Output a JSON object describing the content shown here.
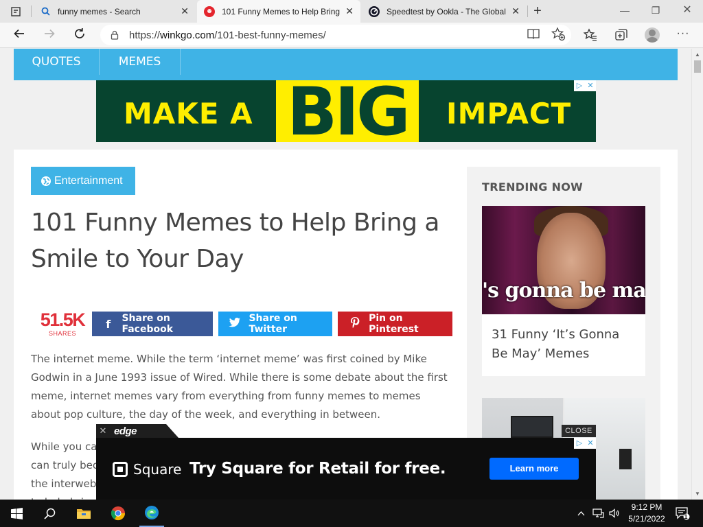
{
  "browser": {
    "tabs": [
      {
        "title": "funny memes - Search",
        "icon": "search-icon"
      },
      {
        "title": "101 Funny Memes to Help Bring",
        "icon": "winkgo-icon"
      },
      {
        "title": "Speedtest by Ookla - The Global",
        "icon": "speedtest-icon"
      }
    ],
    "tab_close": "✕",
    "new_tab": "+",
    "window": {
      "minimize": "—",
      "restore": "❐",
      "close": "✕"
    },
    "address": {
      "prefix": "https://",
      "domain": "winkgo.com",
      "path": "/101-best-funny-memes/"
    },
    "more": "···"
  },
  "site": {
    "nav": [
      "QUOTES",
      "MEMES"
    ],
    "ad_top": {
      "left": "MAKE A",
      "big": "BIG",
      "right": "IMPACT",
      "choices": [
        "▷",
        "✕"
      ]
    },
    "category": "Entertainment",
    "headline": "101 Funny Memes to Help Bring a Smile to Your Day",
    "shares": {
      "count": "51.5K",
      "label": "SHARES"
    },
    "share_buttons": [
      {
        "label": "Share on Facebook",
        "glyph": "f",
        "color": "#3b5998"
      },
      {
        "label": "Share on Twitter",
        "glyph": "🐦",
        "color": "#1da1f2"
      },
      {
        "label": "Pin on Pinterest",
        "glyph": "P",
        "color": "#cb2027"
      }
    ],
    "paragraphs": [
      "The internet meme. While the term ‘internet meme’ was first coined by Mike Godwin in a June 1993 issue of Wired. While there is some debate about the first meme, internet memes vary from everything from funny memes to memes about pop culture, the day of the week, and everything in between.",
      "While you can\ncan truly bec\nthe interweb\nto help bring"
    ],
    "sidebar": {
      "title": "TRENDING NOW",
      "card1": {
        "overlay": "'s gonna be ma",
        "caption": "31 Funny ‘It’s Gonna Be May’ Memes"
      }
    },
    "ad_bottom": {
      "edge_logo": "edge",
      "close": "CLOSE",
      "brand": "Square",
      "headline": "Try Square for Retail for free.",
      "cta": "Learn more"
    }
  },
  "taskbar": {
    "time": "9:12 PM",
    "date": "5/21/2022",
    "notifications": "1"
  }
}
